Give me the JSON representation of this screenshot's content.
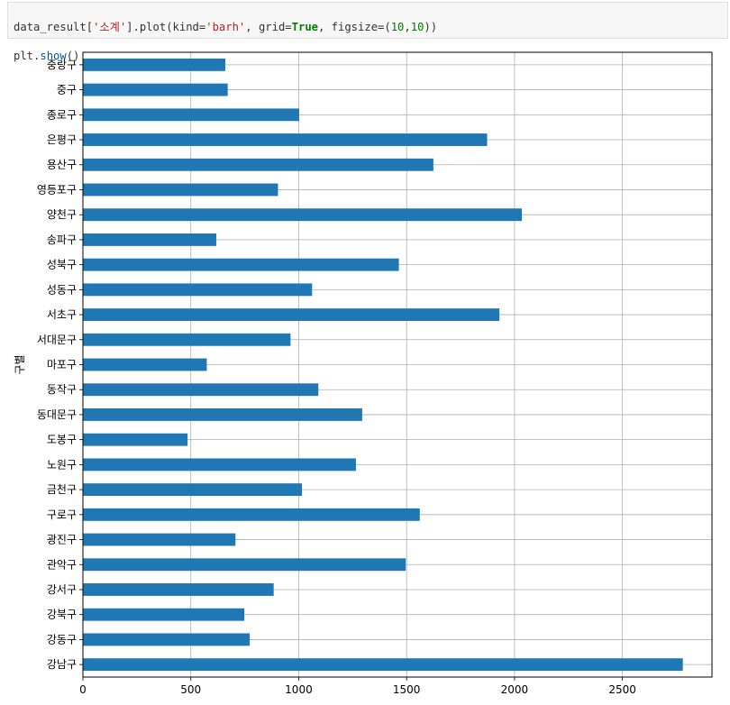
{
  "code": {
    "line1": {
      "var": "data_result[",
      "str": "'소계'",
      "mid": "].plot(kind=",
      "kind": "'barh'",
      "sep1": ", grid=",
      "grid": "True",
      "sep2": ", figsize=(",
      "n1": "10",
      "comma": ",",
      "n2": "10",
      "end": "))"
    },
    "line2": {
      "obj": "plt.",
      "fn": "show",
      "end": "()"
    }
  },
  "chart_data": {
    "type": "bar",
    "orientation": "horizontal",
    "ylabel": "구별",
    "xlabel": "",
    "xlim": [
      0,
      2915
    ],
    "xticks": [
      0,
      500,
      1000,
      1500,
      2000,
      2500
    ],
    "grid": true,
    "bar_color": "#1f77b4",
    "categories": [
      "강남구",
      "강동구",
      "강북구",
      "강서구",
      "관악구",
      "광진구",
      "구로구",
      "금천구",
      "노원구",
      "도봉구",
      "동대문구",
      "동작구",
      "마포구",
      "서대문구",
      "서초구",
      "성동구",
      "성북구",
      "송파구",
      "양천구",
      "영등포구",
      "용산구",
      "은평구",
      "종로구",
      "중구",
      "중랑구"
    ],
    "values": [
      2780,
      773,
      748,
      884,
      1496,
      707,
      1561,
      1015,
      1265,
      485,
      1294,
      1091,
      574,
      962,
      1930,
      1062,
      1464,
      618,
      2034,
      904,
      1624,
      1873,
      1002,
      671,
      660
    ]
  }
}
